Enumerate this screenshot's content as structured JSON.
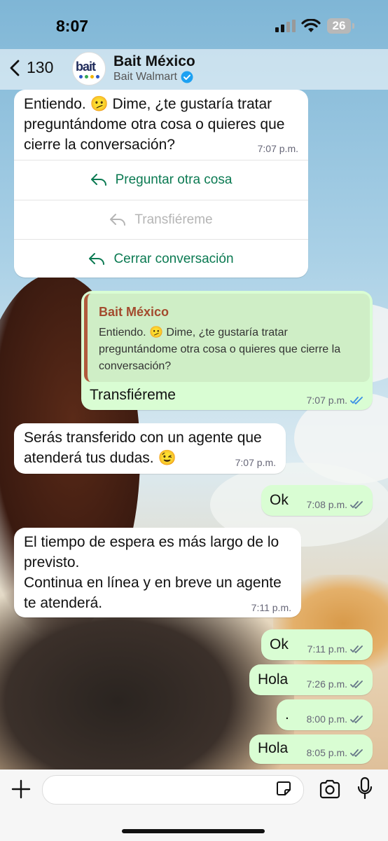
{
  "status_bar": {
    "time": "8:07",
    "battery": "26"
  },
  "header": {
    "back_count": "130",
    "avatar_logo": "bait",
    "title": "Bait México",
    "subtitle": "Bait Walmart"
  },
  "messages": {
    "m1": {
      "text": "Entiendo. 🫤 Dime, ¿te gustaría tratar preguntándome otra cosa o quieres que cierre la conversación?",
      "time": "7:07 p.m.",
      "buttons": [
        "Preguntar otra cosa",
        "Transfiéreme",
        "Cerrar conversación"
      ]
    },
    "m2": {
      "quote_author": "Bait México",
      "quote_text": "Entiendo. 🫤 Dime, ¿te gustaría tratar preguntándome otra cosa o quieres que cierre la conversación?",
      "text": "Transfiéreme",
      "time": "7:07 p.m."
    },
    "m3": {
      "text": "Serás transferido con un agente que atenderá tus dudas. 😉",
      "time": "7:07 p.m."
    },
    "m4": {
      "text": "Ok",
      "time": "7:08 p.m."
    },
    "m5": {
      "line1": "El tiempo de espera es más largo de lo previsto.",
      "line2": "Continua en línea y en breve un agente te atenderá.",
      "time": "7:11 p.m."
    },
    "m6": {
      "text": "Ok",
      "time": "7:11 p.m."
    },
    "m7": {
      "text": "Hola",
      "time": "7:26 p.m."
    },
    "m8": {
      "text": ".",
      "time": "8:00 p.m."
    },
    "m9": {
      "text": "Hola",
      "time": "8:05 p.m."
    }
  },
  "colors": {
    "incoming_bubble": "#ffffff",
    "outgoing_bubble": "#d9fdd3",
    "button_text": "#0b7a52",
    "read_ticks_blue": "#3a8ee6",
    "delivered_ticks_gray": "#667788"
  },
  "icons": {
    "back": "chevron-left-icon",
    "verified": "verified-badge-icon",
    "reply": "reply-arrow-icon",
    "ticks": "double-check-icon",
    "plus": "plus-icon",
    "sticker": "sticker-icon",
    "camera": "camera-icon",
    "mic": "microphone-icon"
  }
}
